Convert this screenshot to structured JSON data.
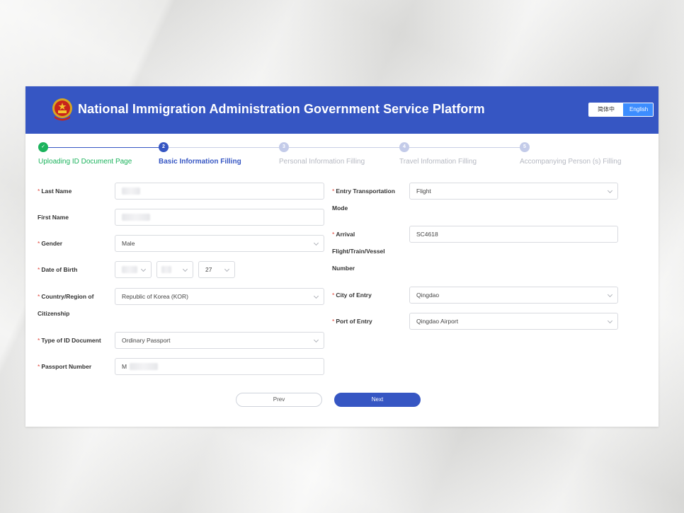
{
  "header": {
    "title": "National Immigration Administration Government Service Platform",
    "lang_zh": "简体中文",
    "lang_en": "English"
  },
  "steps": [
    {
      "num": "✓",
      "label": "Uploading ID Document Page",
      "state": "done"
    },
    {
      "num": "2",
      "label": "Basic Information Filling",
      "state": "active"
    },
    {
      "num": "3",
      "label": "Personal Information Filling",
      "state": "todo"
    },
    {
      "num": "4",
      "label": "Travel Information Filling",
      "state": "todo"
    },
    {
      "num": "5",
      "label": "Accompanying Person (s) Filling",
      "state": "todo"
    }
  ],
  "form": {
    "required_mark": "*",
    "last_name": {
      "label": "Last Name",
      "value": ""
    },
    "first_name": {
      "label": "First Name",
      "value": ""
    },
    "gender": {
      "label": "Gender",
      "value": "Male"
    },
    "dob": {
      "label": "Date of Birth",
      "year": "",
      "month": "",
      "day": "27"
    },
    "citizenship": {
      "label_line1": "Country/Region of",
      "label_line2": "Citizenship",
      "value": "Republic of Korea (KOR)"
    },
    "id_type": {
      "label": "Type of ID Document",
      "value": "Ordinary Passport"
    },
    "passport": {
      "label": "Passport Number",
      "value": "M"
    },
    "transport": {
      "label_line1": "Entry Transportation",
      "label_line2": "Mode",
      "value": "Flight"
    },
    "arrival": {
      "label_line1": "Arrival",
      "label_line2": "Flight/Train/Vessel",
      "label_line3": "Number",
      "value": "SC4618"
    },
    "city": {
      "label": "City of Entry",
      "value": "Qingdao"
    },
    "port": {
      "label": "Port of Entry",
      "value": "Qingdao Airport"
    }
  },
  "buttons": {
    "prev": "Prev",
    "next": "Next"
  },
  "colors": {
    "primary": "#3656c3",
    "done": "#1bb35c",
    "required": "#e1453a"
  }
}
